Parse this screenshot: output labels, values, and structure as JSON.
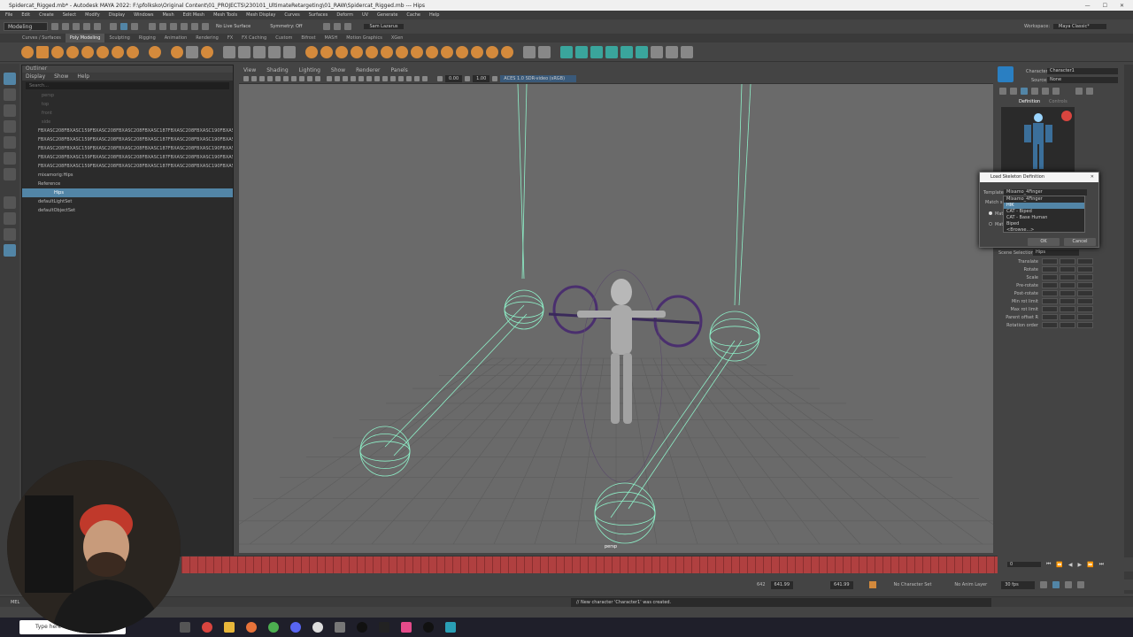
{
  "window": {
    "title": "Spidercat_Rigged.mb* - Autodesk MAYA 2022: F:\\pfolksko\\Original Content\\01_PROJECTS\\230101_UltimateRetargeting\\01_RAW\\Spidercat_Rigged.mb --- Hips"
  },
  "menubar": [
    "File",
    "Edit",
    "Create",
    "Select",
    "Modify",
    "Display",
    "Windows",
    "Mesh",
    "Edit Mesh",
    "Mesh Tools",
    "Mesh Display",
    "Curves",
    "Surfaces",
    "Deform",
    "UV",
    "Generate",
    "Cache",
    "Help"
  ],
  "status": {
    "mode": "Modeling",
    "live_surface": "No Live Surface",
    "symmetry": "Symmetry: Off",
    "user": "Sam Lazarus",
    "workspace_label": "Workspace:",
    "workspace": "Maya Classic*"
  },
  "shelf_tabs": [
    "Curves / Surfaces",
    "Poly Modeling",
    "Sculpting",
    "Rigging",
    "Animation",
    "Rendering",
    "FX",
    "FX Caching",
    "Custom",
    "Bifrost",
    "MASH",
    "Motion Graphics",
    "XGen"
  ],
  "shelf_active_index": 1,
  "outliner": {
    "title": "Outliner",
    "menu": [
      "Display",
      "Show",
      "Help"
    ],
    "search_placeholder": "Search...",
    "items": [
      {
        "label": "persp",
        "dim": true
      },
      {
        "label": "top",
        "dim": true
      },
      {
        "label": "front",
        "dim": true
      },
      {
        "label": "side",
        "dim": true
      },
      {
        "label": "FBXASC208FBXASC159FBXASC208FBXASC208FBXASC187FBXASC208FBXASC190FBXASC208F"
      },
      {
        "label": "FBXASC208FBXASC159FBXASC208FBXASC208FBXASC187FBXASC208FBXASC190FBXASC208F"
      },
      {
        "label": "FBXASC208FBXASC159FBXASC208FBXASC208FBXASC187FBXASC208FBXASC190FBXASC208F"
      },
      {
        "label": "FBXASC208FBXASC159FBXASC208FBXASC208FBXASC187FBXASC208FBXASC190FBXASC208F"
      },
      {
        "label": "FBXASC208FBXASC159FBXASC208FBXASC208FBXASC187FBXASC208FBXASC190FBXASC208F"
      },
      {
        "label": "mixamorig:Hips"
      },
      {
        "label": "Reference"
      },
      {
        "label": "Hips",
        "selected": true
      },
      {
        "label": "defaultLightSet"
      },
      {
        "label": "defaultObjectSet"
      }
    ]
  },
  "viewport": {
    "menu": [
      "View",
      "Shading",
      "Lighting",
      "Show",
      "Renderer",
      "Panels"
    ],
    "exposure": "0.00",
    "gamma": "1.00",
    "colorspace": "ACES 1.0 SDR-video (sRGB)",
    "camera_label": "persp"
  },
  "hik": {
    "character_label": "Character:",
    "character": "Character1",
    "source_label": "Source:",
    "source": "None",
    "tabs": [
      "Definition",
      "Controls"
    ],
    "scene_selection_label": "Scene Selection:",
    "scene_selection": "Hips",
    "attrs": [
      "Translate",
      "Rotate",
      "Scale",
      "Pre-rotate",
      "Post-rotate",
      "Min rot limit",
      "Max rot limit",
      "Parent offset R",
      "Rotation order"
    ]
  },
  "dialog": {
    "title": "Load Skeleton Definition",
    "template_label": "Template:",
    "template_value": "Mixamo_4Finger",
    "match_label": "Match s",
    "match_options": [
      "Matc",
      "Mat"
    ],
    "options": [
      "Mixamo_4Finger",
      "HIK",
      "CAT - Biped",
      "CAT - Base Human",
      "Biped",
      "<Browse...>"
    ],
    "selected_index": 1,
    "ok": "OK",
    "cancel": "Cancel"
  },
  "playback": {
    "current_frame": "0"
  },
  "range": {
    "start": "642",
    "anim_start": "641.99",
    "anim_end": "641.99",
    "char_set": "No Character Set",
    "anim_layer": "No Anim Layer",
    "fps": "30 fps"
  },
  "command": {
    "language": "MEL",
    "response": "// New character 'Character1' was created."
  },
  "taskbar": {
    "search_placeholder": "Type here to search"
  },
  "colors": {
    "accent": "#5285a6",
    "shelf_orange": "#d48a3c",
    "shelf_teal": "#3aa59c",
    "timeline": "#b04040",
    "joint_line": "#8ef0c8"
  }
}
